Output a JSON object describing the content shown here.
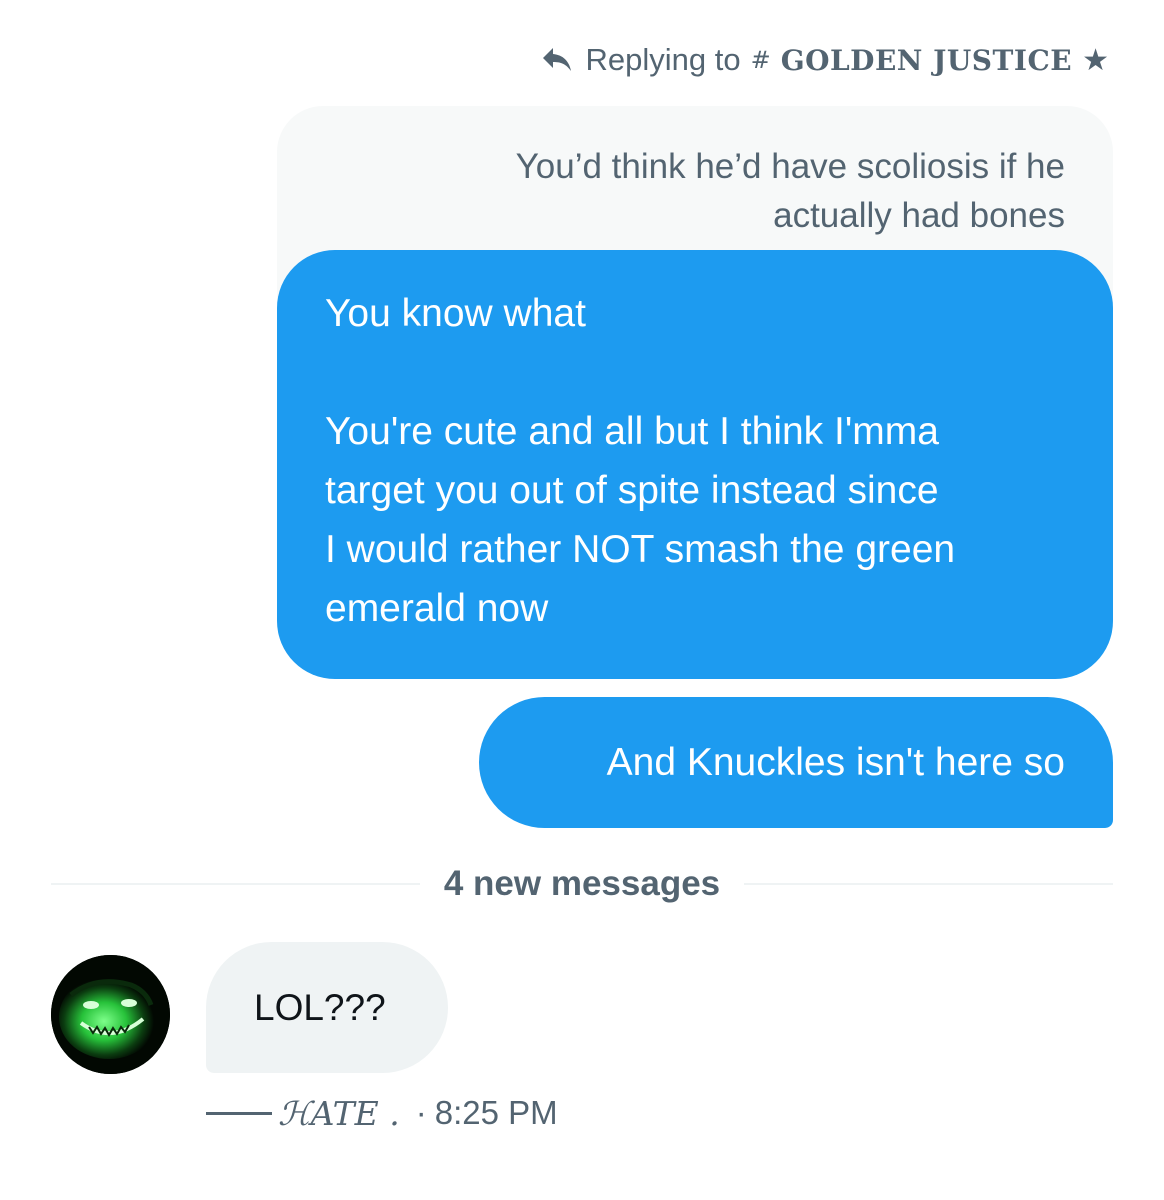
{
  "reply_context": {
    "prefix": "Replying to",
    "hash": "#",
    "name": "GOLDEN JUSTICE",
    "star": "★",
    "icon": "reply-arrow-icon"
  },
  "quoted_message": {
    "line1": "You’d think he’d have scoliosis if he",
    "line2": "actually had bones"
  },
  "outgoing_messages": [
    {
      "lines": [
        "You know what",
        "",
        "You're cute and all but I think I'mma",
        "target you out of spite instead since",
        "I would rather NOT smash the green",
        "emerald now"
      ]
    },
    {
      "text": "And Knuckles isn't here so"
    }
  ],
  "divider": {
    "label": "4 new messages"
  },
  "incoming_message": {
    "text": "LOL???",
    "sender": "ℋATE .",
    "dot": "·",
    "time": "8:25 PM"
  },
  "colors": {
    "accent": "#1d9bf0",
    "secondary_text": "#536471",
    "incoming_bg": "#eff3f4",
    "quote_bg": "#f7f9f9"
  }
}
